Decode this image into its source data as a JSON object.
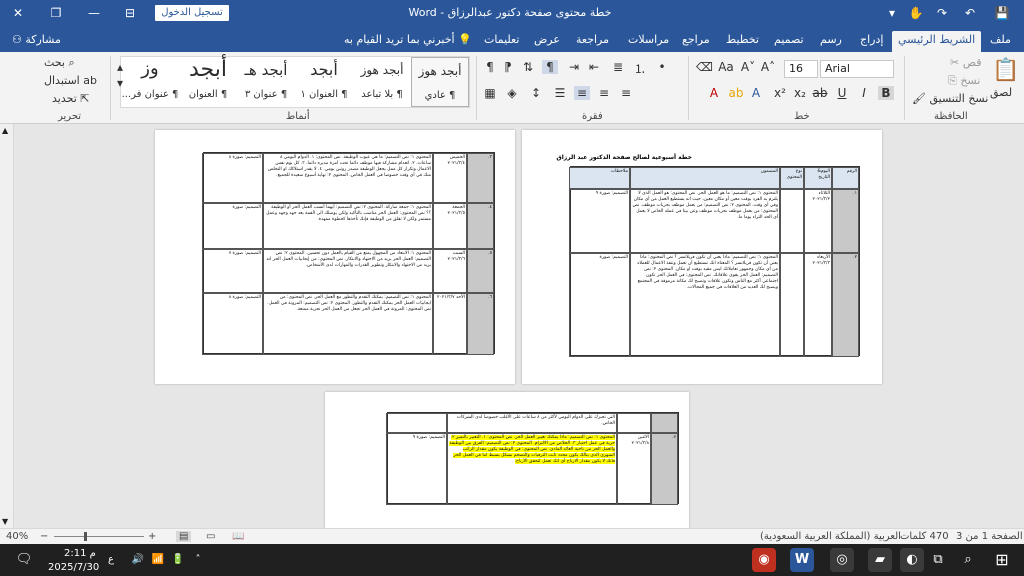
{
  "titlebar": {
    "title": "خطة محتوى صفحة دكتور عبدالرزاق  -  Word",
    "sign_in": "تسجيل الدخول",
    "close": "✕",
    "restore": "❐",
    "minimize": "—",
    "ribbon_display": "⊟",
    "save": "💾",
    "undo": "↶",
    "redo": "↷",
    "touch": "✋",
    "customize": "▾"
  },
  "tabs": [
    "ملف",
    "الشريط الرئيسي",
    "إدراج",
    "رسم",
    "تصميم",
    "تخطيط",
    "مراجع",
    "مراسلات",
    "مراجعة",
    "عرض",
    "تعليمات",
    "أخبرني بما تريد القيام به"
  ],
  "tabs_active_index": 1,
  "share": "مشاركة",
  "ribbon": {
    "clipboard": {
      "label": "الحافظة",
      "paste": "لصق",
      "cut": "قص",
      "copy": "نسخ",
      "format_painter": "نسخ التنسيق"
    },
    "font": {
      "label": "خط",
      "font_name": "Arial",
      "font_size": "16"
    },
    "paragraph": {
      "label": "فقرة"
    },
    "styles": {
      "label": "أنماط",
      "items": [
        {
          "preview": "أبجد هوز",
          "name": "¶ عادي"
        },
        {
          "preview": "أبجد هوز",
          "name": "¶ بلا تباعد"
        },
        {
          "preview": "أبجد",
          "name": "¶ العنوان ١"
        },
        {
          "preview": "أبجد هـ",
          "name": "¶ عنوان ٣"
        },
        {
          "preview": "أبجد",
          "name": "¶ العنوان"
        },
        {
          "preview": "أبجد",
          "name": "¶ العنوان"
        },
        {
          "preview": "وز",
          "name": "¶ عنوان فر..."
        }
      ]
    },
    "editing": {
      "label": "تحرير",
      "find": "بحث",
      "replace": "استبدال",
      "select": "تحديد"
    }
  },
  "document": {
    "page1_title": "خطة أسبوعية لصالح صفحة الدكتور عبد الرزاق",
    "headers": [
      "الرقم",
      "اليوم& التاريخ",
      "نوع المحتوى",
      "المضمون",
      "ملاحظات"
    ],
    "page1_rows": [
      {
        "num": "١.",
        "day": "الثلاثاء ٢٠٢١/٣/٢",
        "content": "المحتوى ١: نص التصميم: ما هو العمل الحر. نص المحتوى: هو العمل الذي لا يلتزم به الفرد بوقت معين أو مكان معين، حيث انه يستطيع العمل من أي مكان وفي أي وقت. المحتوى ٢: نص التصميم: من يعمل موظف بحريات موظف. نص المحتوى: من يعمل موظف بحريات موظف وعن بيتا في عمله الخاص لا يعمل أي الحد الثراء يوما ما.",
        "notes": "التصميم: صورة ٩"
      },
      {
        "num": "٢.",
        "day": "الأربعاء ٢٠٢١/٣/٣",
        "content": "المحتوى ١: نص التصميم: ماذا يعني أن تكون فريلانسر ؟ نص المحتوى: ماذا يعني أن تكون فريلانسر ؟ المعناه انك تستطيع أن تعمل وتنفذ الاعمال للعملاء من أي مكان وجمهور تعاملاتك ليس مقيد بوقت او مكان. المحتوى ٢: نص التصميم: العمل الحر يقوي علاقاتك. نص المحتوى: في العمل الحر تكون اجتماعي أكثر مع الناس وتكون علاقات وتصبح لك مكانة مرموقة في المجتمع ويصبح لك العديد من العلاقات في جميع المجالات.",
        "notes": "التصميم: صورة"
      }
    ],
    "page2_rows": [
      {
        "num": "٣.",
        "day": "الخميس ٢٠٢١/٣/٤",
        "content": "المحتوى ١: نص التصميم: ما هي عيوب الوظيفة. نص المحتوى: ١. الدوام اليومي ٨ ساعات. ٢. انعدام مشاركة فيها موظف دائما تحت امرة مديره دائما. ٣. كل يوم نفس الاعمال وتكرار كل ممل يجعل الوظيفة مصدر روتين يومي. ٤. لا يقدر استلاكك او التخلص منك في أي وقت خصوصا في العمل الخاص. المحتوى ٢: نهاية أسبوع سعيدة للجميع.",
        "notes": "التصميم: صورة ٨"
      },
      {
        "num": "٤.",
        "day": "الجمعة ٢٠٢١/٣/٥",
        "content": "المحتوى ١: جمعة مباركة. المحتوى ٢: نص التصميم: أيهما أنسب العمل الحر أو الوظيفة ؟؟ نص المحتوى: العمل الحر مناسب بالتأكيد ولكن يوصلك الى القمة بعد جهد وجهد وعمل مستمر ولكن لا تقلق من الوظيفة فإنك تأخذها كخطوة ممهدة.",
        "notes": "التصميم: صورة"
      },
      {
        "num": "٥.",
        "day": "السبت ٢٠٢١/٣/٦",
        "content": "المحتوى ١: الابتعاد من المجهول يمنع من القيام بالعمل دون تحسين. المحتوى ٢: نص التصميم: العمل الحر يزيد من الاجتهاد والابتكار. نص المحتوى: من إيجابيات العمل الحر انه يزيد من الاجتهاد والابتكار وتطوير القدرات والمهارات لدى الأشخاص.",
        "notes": "التصميم: صورة ٧"
      },
      {
        "num": "٦.",
        "day": "الأحد ٢٠٢١/٣/٧",
        "content": "المحتوى ١: نص التصميم: يمكنك التقدم والتطور مع العمل الحر. نص المحتوى: من ايجابيات العمل الحر يمكنك التقدم والتطور. المحتوى ٢: نص التصميم: المرونة في العمل. نص المحتوى: المرونة في العمل الحر تجعل من العمل الحر تجربة ممتعة.",
        "notes": "التصميم: صورة ٨"
      }
    ],
    "page3_rows": [
      {
        "num": "",
        "day": "",
        "content": "التي تجبرك على الدوام اليومي لأكثر من ٨ ساعات على الأغلب خصوصا لدى الشركات الخاص.",
        "notes": ""
      },
      {
        "num": "٧.",
        "day": "الاثنين ٢٠٢١/٣/٨",
        "content": "المحتوى ١: نص التصميم: ماذا يمكنك تغيير العمل الحر. نص المحتوى: ١. التعبير بالتميز ٢. حرية في عمل اختيار ٣. الخلاص من الالتزام. المحتوى ٢: نص التصميم: الفرق بين الوظيفة والعمل الحر من ناحية العائد المادي. نص المحتوى: في الوظيفة يكون مقدار الراتب الشهري الذي ينالك يكون محدد ثابت الترقيات والتضخم بشكل بسيط اما في العمل الحر فانك لا يكون مقدار الارباح أي انك تعمل لتحقق الأرباح.",
        "notes": "التصميم: صورة ٩"
      }
    ]
  },
  "status": {
    "page": "الصفحة 1 من 3",
    "words": "470 كلمات",
    "lang": "العربية (المملكة العربية السعودية)",
    "zoom": "40%"
  },
  "taskbar": {
    "time": "2:11 م",
    "date": "2025/7/30",
    "lang": "ع"
  }
}
